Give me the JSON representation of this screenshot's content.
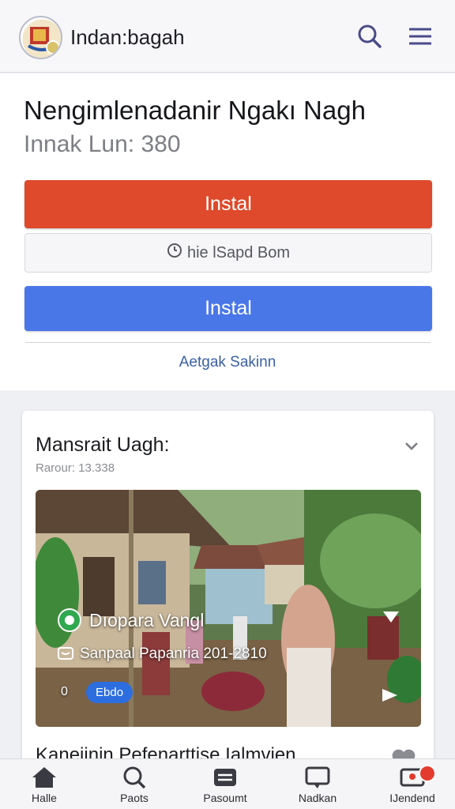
{
  "header": {
    "app_title": "Indan:bagah",
    "search_icon": "search-icon",
    "menu_icon": "hamburger-menu-icon"
  },
  "hero": {
    "title": "Nengimlenadanir Ngakı Nagh",
    "subtitle": "Innak  Lun: 380",
    "primary_button": "Instal",
    "secondary_button": "hie lSapd Bom",
    "blue_button": "Instal",
    "link": "Aetgak Sakinn",
    "colors": {
      "primary": "#de4a2b",
      "blue": "#4a77e8"
    }
  },
  "card": {
    "title": "Mansrait Uagh:",
    "meta": "Rarour: 13.338",
    "overlay_title": "Dıopara Vangl",
    "overlay_subtitle": "Sanpaal Papanria 201-2810",
    "overlay_count": "0",
    "overlay_badge": "Ebdo",
    "next_title": "Kaneiinin Pefenarttise Ialmvien"
  },
  "bottom_nav": {
    "items": [
      {
        "label": "Halle",
        "icon": "home-icon"
      },
      {
        "label": "Paots",
        "icon": "search-icon"
      },
      {
        "label": "Pasoumt",
        "icon": "wallet-icon"
      },
      {
        "label": "Nadkan",
        "icon": "chat-icon"
      },
      {
        "label": "IJendend",
        "icon": "profile-icon"
      }
    ]
  }
}
